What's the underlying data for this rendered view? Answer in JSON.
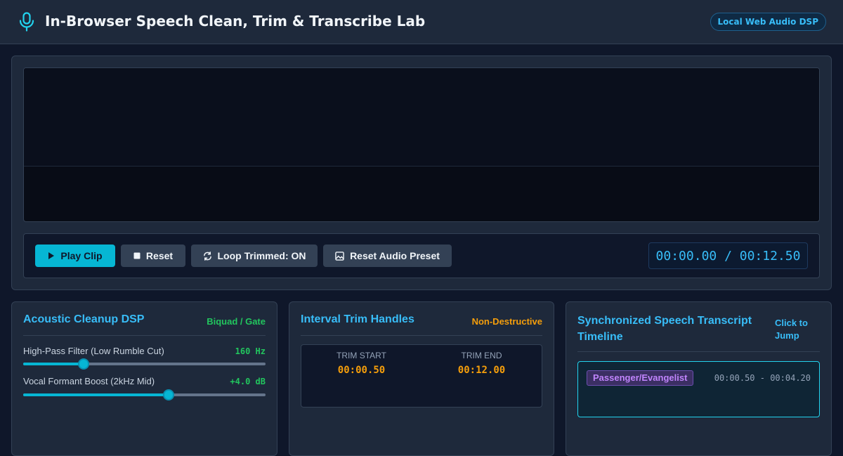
{
  "header": {
    "title": "In-Browser Speech Clean, Trim & Transcribe Lab",
    "badge": "Local Web Audio DSP",
    "icon": "microphone-icon"
  },
  "player": {
    "buttons": {
      "play": "Play Clip",
      "reset": "Reset",
      "loop": "Loop Trimmed: ON",
      "preset": "Reset Audio Preset"
    },
    "time": "00:00.00 / 00:12.50"
  },
  "dsp": {
    "title": "Acoustic Cleanup DSP",
    "tag": "Biquad / Gate",
    "sliders": [
      {
        "label": "High-Pass Filter (Low Rumble Cut)",
        "value": "160 Hz",
        "fraction": 0.25
      },
      {
        "label": "Vocal Formant Boost (2kHz Mid)",
        "value": "+4.0 dB",
        "fraction": 0.6
      }
    ]
  },
  "trim": {
    "title": "Interval Trim Handles",
    "tag": "Non-Destructive",
    "start_label": "TRIM START",
    "start_value": "00:00.50",
    "end_label": "TRIM END",
    "end_value": "00:12.00"
  },
  "transcript": {
    "title": "Synchronized Speech Transcript Timeline",
    "hint": "Click to Jump",
    "segments": [
      {
        "speaker": "Passenger/Evangelist",
        "range": "00:00.50 - 00:04.20"
      }
    ]
  },
  "colors": {
    "accent": "#06b6d4",
    "heading": "#38bdf8",
    "green": "#22c55e",
    "amber": "#f59e0b",
    "purple": "#c084fc"
  }
}
